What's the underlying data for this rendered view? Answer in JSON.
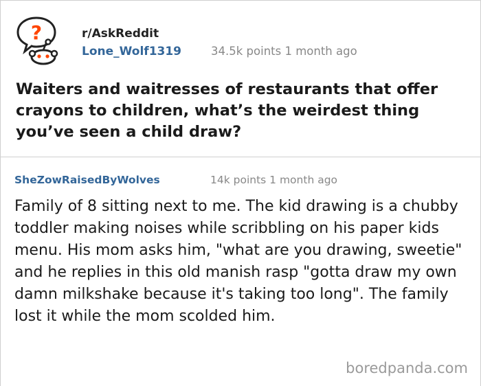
{
  "post": {
    "subreddit": "r/AskReddit",
    "username": "Lone_Wolf1319",
    "points": "34.5k points",
    "age": "1 month ago",
    "title": "Waiters and waitresses of restaurants that offer crayons to children, what’s the weirdest thing you’ve seen a child draw?",
    "avatar_question_mark": "?"
  },
  "comment": {
    "username": "SheZowRaisedByWolves",
    "points": "14k points",
    "age": "1 month ago",
    "body": "Family of 8 sitting next to me. The kid drawing is a chubby toddler making noises while scribbling on his paper kids menu. His mom asks him, \"what are you drawing, sweetie\" and he replies in this old manish rasp \"gotta draw my own damn milkshake because it's taking too long\". The family lost it while the mom scolded him."
  },
  "watermark": "boredpanda.com",
  "colors": {
    "username": "#336699",
    "meta": "#888888",
    "avatar_accent": "#ff4500",
    "border": "#cfcfcf"
  }
}
